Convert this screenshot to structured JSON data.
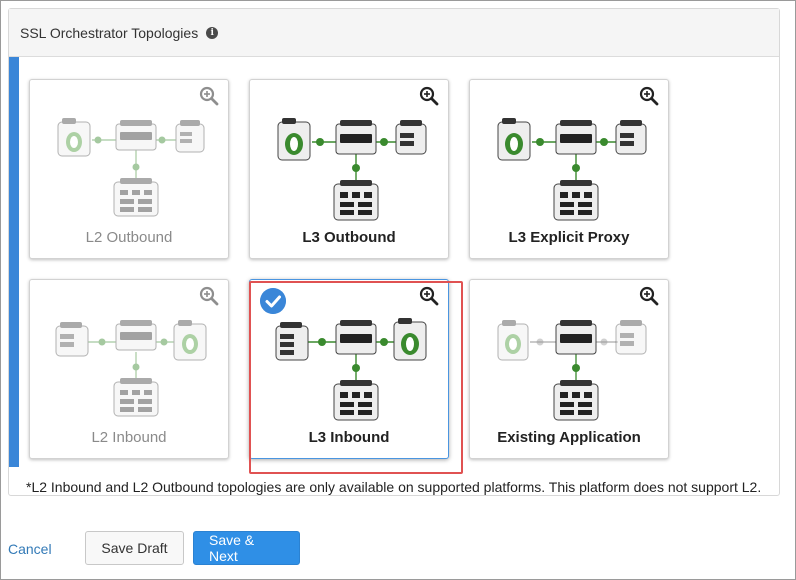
{
  "panel": {
    "title": "SSL Orchestrator Topologies",
    "info_icon": "info-icon"
  },
  "topologies": [
    {
      "id": "l2-outbound",
      "label": "L2 Outbound",
      "enabled": false,
      "selected": false
    },
    {
      "id": "l3-outbound",
      "label": "L3 Outbound",
      "enabled": true,
      "selected": false
    },
    {
      "id": "l3-explicit-proxy",
      "label": "L3 Explicit Proxy",
      "enabled": true,
      "selected": false
    },
    {
      "id": "l2-inbound",
      "label": "L2 Inbound",
      "enabled": false,
      "selected": false
    },
    {
      "id": "l3-inbound",
      "label": "L3 Inbound",
      "enabled": true,
      "selected": true
    },
    {
      "id": "existing-application",
      "label": "Existing Application",
      "enabled": true,
      "selected": false
    }
  ],
  "footnote": "*L2 Inbound and L2 Outbound topologies are only available on supported platforms. This platform does not support L2.",
  "footer": {
    "cancel_label": "Cancel",
    "save_draft_label": "Save Draft",
    "save_next_label": "Save & Next"
  },
  "colors": {
    "accent": "#3a86d8",
    "primary_button": "#2f8fe6",
    "selection_outline": "#e05252",
    "diagram_green": "#3a8a2e"
  }
}
